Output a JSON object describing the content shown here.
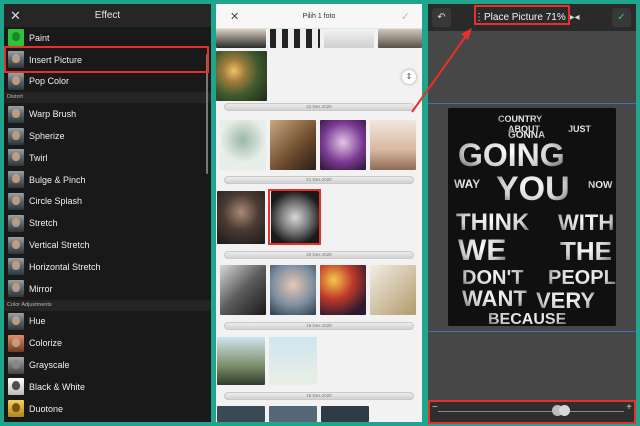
{
  "effect_panel": {
    "title": "Effect",
    "items_top": [
      {
        "label": "Paint",
        "thumb": "green"
      },
      {
        "label": "Insert Picture",
        "thumb": "face"
      },
      {
        "label": "Pop Color",
        "thumb": "face"
      }
    ],
    "section_distort": "Distort",
    "items_distort": [
      {
        "label": "Warp Brush",
        "thumb": "face"
      },
      {
        "label": "Spherize",
        "thumb": "face"
      },
      {
        "label": "Twirl",
        "thumb": "face"
      },
      {
        "label": "Bulge & Pinch",
        "thumb": "face"
      },
      {
        "label": "Circle Splash",
        "thumb": "face"
      },
      {
        "label": "Stretch",
        "thumb": "face"
      },
      {
        "label": "Vertical Stretch",
        "thumb": "face"
      },
      {
        "label": "Horizontal Stretch",
        "thumb": "face"
      },
      {
        "label": "Mirror",
        "thumb": "face"
      }
    ],
    "section_color": "Color Adjustments",
    "items_color": [
      {
        "label": "Hue",
        "thumb": "face"
      },
      {
        "label": "Colorize",
        "thumb": "colz"
      },
      {
        "label": "Grayscale",
        "thumb": "gray"
      },
      {
        "label": "Black & White",
        "thumb": "bw"
      },
      {
        "label": "Duotone",
        "thumb": "duo"
      }
    ]
  },
  "picker_panel": {
    "title": "Pilih 1 foto",
    "dates": [
      "22 Des 2020",
      "21 Des 2020",
      "20 Des 2020",
      "19 Des 2020",
      "18 Des 2020"
    ]
  },
  "place_panel": {
    "title": "Place Picture 71%",
    "poster_words": [
      "GOING",
      "YOU",
      "THINK",
      "WITH",
      "WE",
      "THE",
      "DON'T",
      "PEOPL",
      "WANT",
      "VERY",
      "BECAUSE",
      "GONNA",
      "WAY",
      "NOW",
      "COUNTRY",
      "ABOUT",
      "JUST"
    ]
  },
  "colors": {
    "background": "#1fa58c",
    "highlight": "#e8302a",
    "confirm": "#3ccf4e"
  },
  "icons": {
    "close": "close-icon",
    "check": "check-icon",
    "undo": "undo-icon",
    "flip": "flip-icon",
    "more": "more-vert-icon",
    "scroll": "sort-icon"
  }
}
